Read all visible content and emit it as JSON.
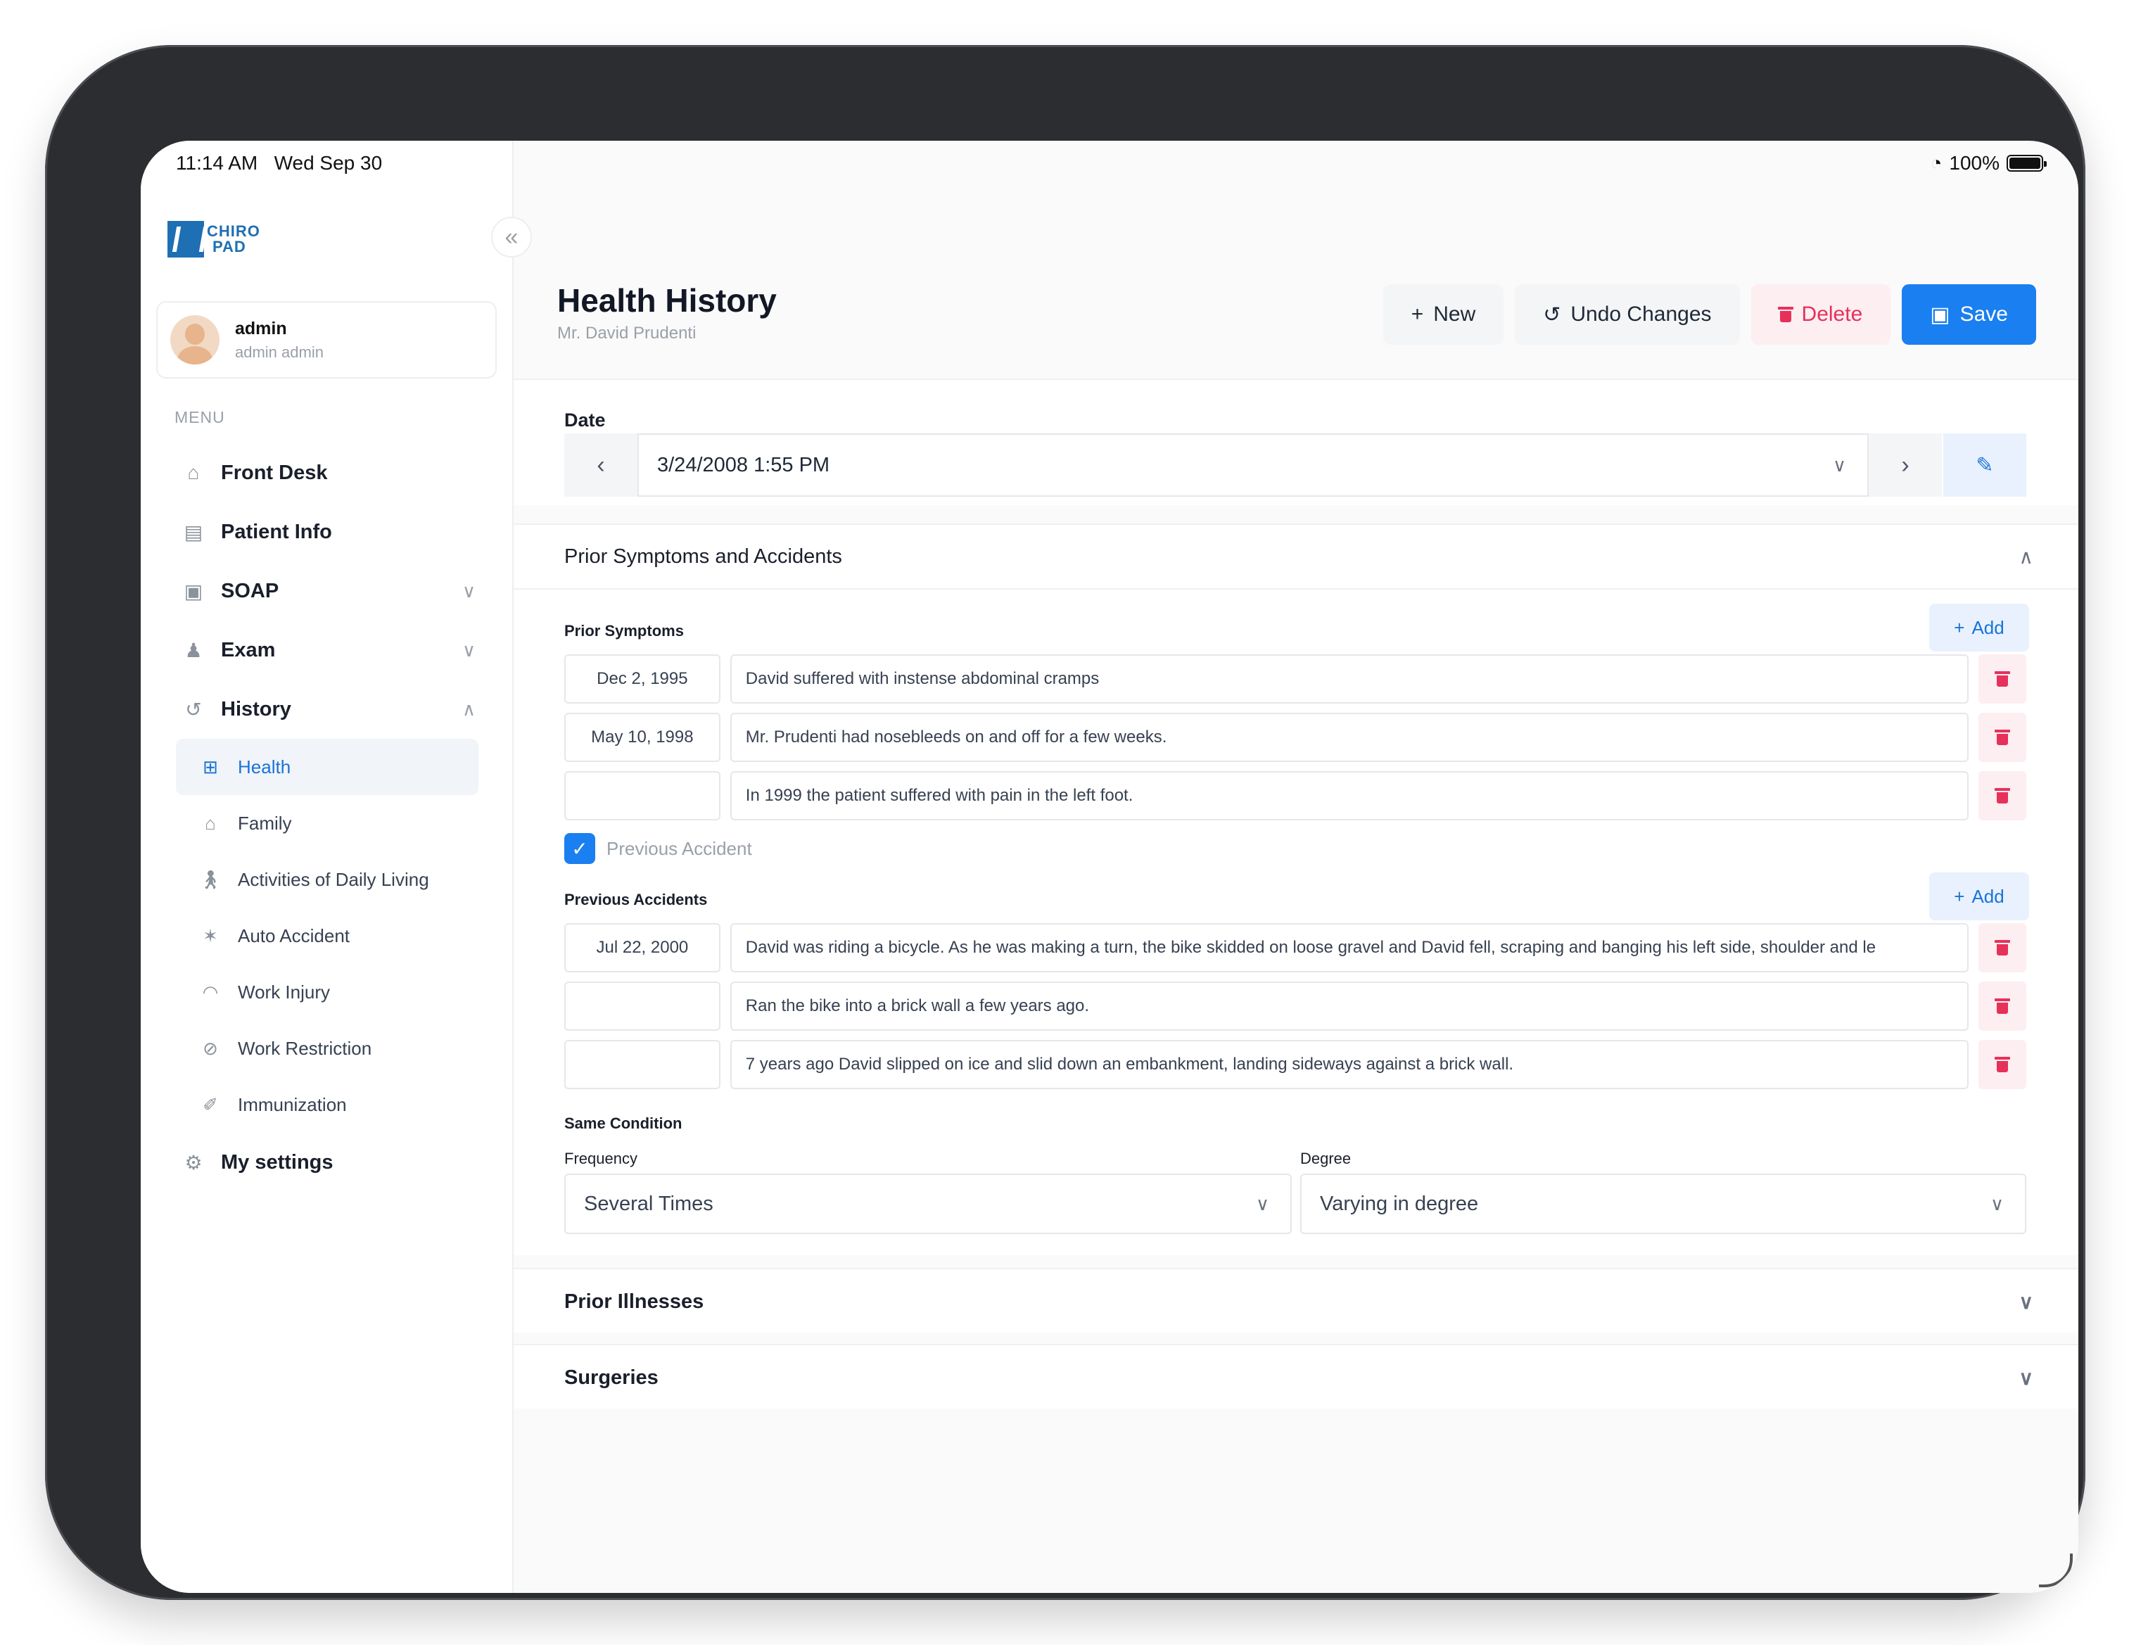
{
  "status": {
    "time": "11:14 AM",
    "date": "Wed Sep 30",
    "battery": "100%"
  },
  "brand": {
    "logo_line1": "CHIRO",
    "logo_line2": "PAD"
  },
  "user": {
    "name": "admin",
    "subtitle": "admin admin"
  },
  "sidebar": {
    "menu_label": "MENU",
    "items": [
      {
        "label": "Front Desk",
        "icon": "home-icon"
      },
      {
        "label": "Patient Info",
        "icon": "id-card-icon"
      },
      {
        "label": "SOAP",
        "icon": "clipboard-icon",
        "expandable": true
      },
      {
        "label": "Exam",
        "icon": "person-icon",
        "expandable": true
      },
      {
        "label": "History",
        "icon": "history-icon",
        "expanded": true
      }
    ],
    "history_sub": [
      {
        "label": "Health",
        "icon": "health-icon",
        "active": true
      },
      {
        "label": "Family",
        "icon": "family-icon"
      },
      {
        "label": "Activities of Daily Living",
        "icon": "walking-icon"
      },
      {
        "label": "Auto Accident",
        "icon": "car-crash-icon"
      },
      {
        "label": "Work Injury",
        "icon": "hard-hat-icon"
      },
      {
        "label": "Work Restriction",
        "icon": "ban-icon"
      },
      {
        "label": "Immunization",
        "icon": "syringe-icon"
      }
    ],
    "settings": {
      "label": "My settings",
      "icon": "gear-icon"
    }
  },
  "header": {
    "title": "Health History",
    "patient": "Mr. David Prudenti"
  },
  "toolbar": {
    "new_label": "New",
    "undo_label": "Undo Changes",
    "delete_label": "Delete",
    "save_label": "Save"
  },
  "date_section": {
    "label": "Date",
    "value": "3/24/2008 1:55 PM"
  },
  "prior_section": {
    "title": "Prior Symptoms and Accidents",
    "symptoms_label": "Prior Symptoms",
    "add_label": "Add",
    "symptoms": [
      {
        "date": "Dec 2, 1995",
        "text": "David suffered with instense abdominal cramps"
      },
      {
        "date": "May 10, 1998",
        "text": "Mr. Prudenti had nosebleeds on and off for a few weeks."
      },
      {
        "date": "",
        "text": "In 1999 the patient suffered with pain in the left foot."
      }
    ],
    "previous_accident_checkbox": "Previous Accident",
    "previous_accident_checked": true,
    "accidents_label": "Previous Accidents",
    "accidents": [
      {
        "date": "Jul 22, 2000",
        "text": "David was riding a bicycle. As he was making a turn, the bike skidded on loose gravel and David fell, scraping and banging his left side, shoulder and le"
      },
      {
        "date": "",
        "text": "Ran the bike into a brick wall a few years ago."
      },
      {
        "date": "",
        "text": "7 years ago David slipped on ice and slid down an embankment, landing sideways against a brick wall."
      }
    ],
    "same_condition_label": "Same Condition",
    "frequency_label": "Frequency",
    "frequency_value": "Several Times",
    "degree_label": "Degree",
    "degree_value": "Varying in degree"
  },
  "collapsed_sections": {
    "illnesses": "Prior Illnesses",
    "surgeries": "Surgeries"
  }
}
